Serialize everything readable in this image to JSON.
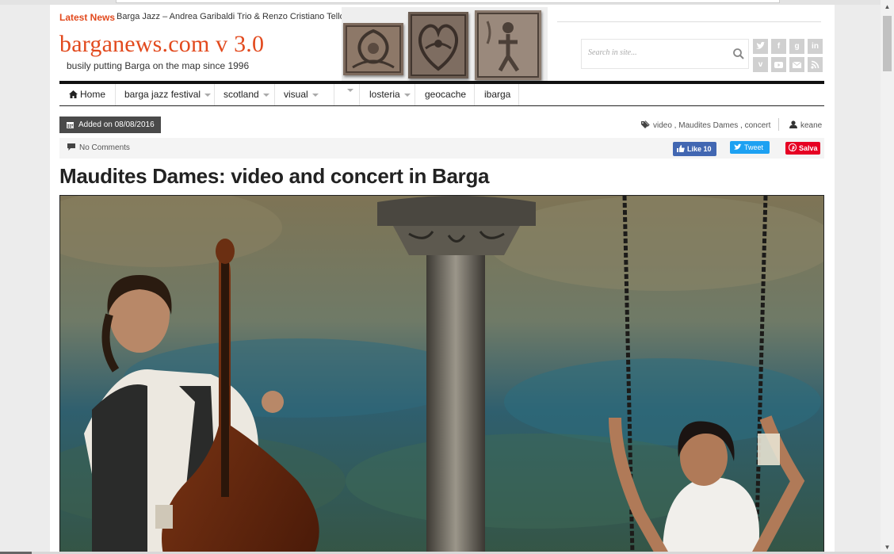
{
  "latest_news": {
    "label": "Latest News",
    "headline": "Barga Jazz – Andrea Garibaldi Trio & Renzo Cristiano Telloli"
  },
  "logo": {
    "title": "barganews.com v 3.0",
    "tagline": "busily putting Barga on the map since 1996"
  },
  "search": {
    "placeholder": "Search in site..."
  },
  "social": [
    "twitter-icon",
    "facebook-icon",
    "google-plus-icon",
    "linkedin-icon",
    "vimeo-icon",
    "youtube-icon",
    "email-icon",
    "rss-icon"
  ],
  "nav": {
    "items": [
      {
        "label": "Home",
        "icon": "home-icon"
      },
      {
        "label": "barga jazz festival"
      },
      {
        "label": "scotland"
      },
      {
        "label": "visual"
      },
      {
        "label": ""
      },
      {
        "label": "losteria"
      },
      {
        "label": "geocache"
      },
      {
        "label": "ibarga"
      }
    ]
  },
  "meta": {
    "date": "Added on 08/08/2016",
    "tags": [
      "video",
      "Maudites Dames",
      "concert"
    ],
    "author": "keane",
    "comments": "No Comments"
  },
  "share": {
    "facebook": "Like 10",
    "twitter": "Tweet",
    "pinterest": "Salva"
  },
  "article": {
    "title": "Maudites Dames: video and concert in Barga"
  },
  "colors": {
    "brand": "#e24a1e",
    "nav_bar": "#111111",
    "facebook": "#4267b2",
    "twitter": "#1da1f2",
    "pinterest": "#e60023"
  }
}
